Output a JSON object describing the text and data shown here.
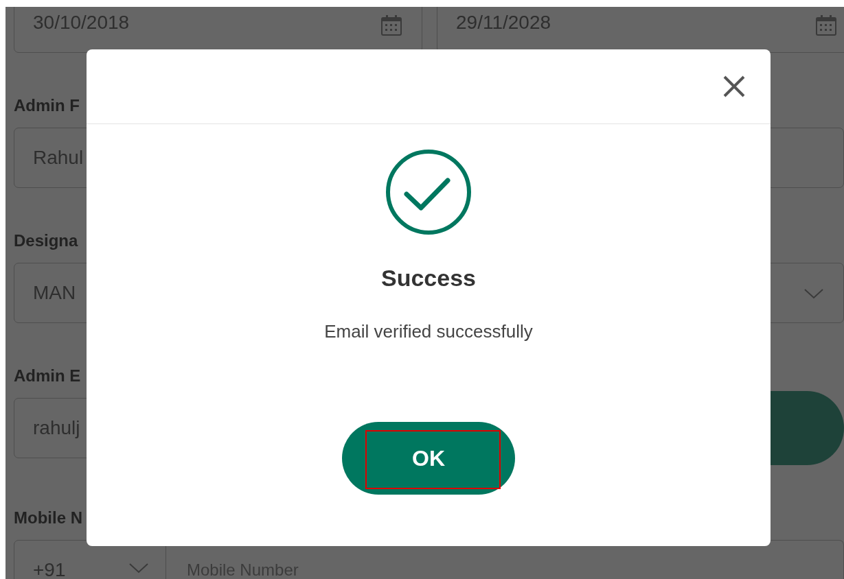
{
  "background_form": {
    "dates": [
      {
        "value": "30/10/2018"
      },
      {
        "value": "29/11/2028"
      }
    ],
    "admin_name": {
      "label": "Admin F",
      "value": "Rahul"
    },
    "designation": {
      "label": "Designa",
      "value": "MAN"
    },
    "admin_email": {
      "label": "Admin E",
      "value": "rahulj"
    },
    "mobile": {
      "label": "Mobile N",
      "country_code": "+91",
      "placeholder": "Mobile Number"
    }
  },
  "dialog": {
    "title": "Success",
    "message": "Email verified successfully",
    "ok_button": "OK",
    "ok_button_highlighted": true
  }
}
